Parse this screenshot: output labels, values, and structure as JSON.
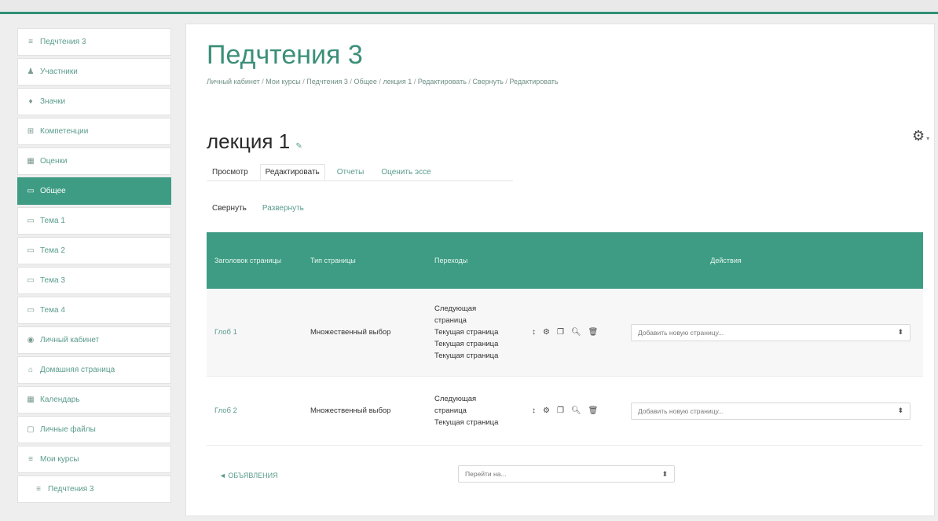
{
  "topbar": {
    "breadcrumb_faint": ""
  },
  "sidebar": {
    "items": [
      {
        "icon": "graduation-cap-icon",
        "glyph": "≡",
        "label": "Педчтения 3"
      },
      {
        "icon": "users-icon",
        "glyph": "♟",
        "label": "Участники"
      },
      {
        "icon": "badge-icon",
        "glyph": "♦",
        "label": "Значки"
      },
      {
        "icon": "competencies-icon",
        "glyph": "⊞",
        "label": "Компетенции"
      },
      {
        "icon": "grades-icon",
        "glyph": "▦",
        "label": "Оценки"
      },
      {
        "icon": "folder-icon",
        "glyph": "▭",
        "label": "Общее",
        "active": true
      },
      {
        "icon": "folder-icon",
        "glyph": "▭",
        "label": "Тема 1"
      },
      {
        "icon": "folder-icon",
        "glyph": "▭",
        "label": "Тема 2"
      },
      {
        "icon": "folder-icon",
        "glyph": "▭",
        "label": "Тема 3"
      },
      {
        "icon": "folder-icon",
        "glyph": "▭",
        "label": "Тема 4"
      },
      {
        "icon": "dashboard-icon",
        "glyph": "◉",
        "label": "Личный кабинет"
      },
      {
        "icon": "home-icon",
        "glyph": "⌂",
        "label": "Домашняя страница"
      },
      {
        "icon": "calendar-icon",
        "glyph": "▦",
        "label": "Календарь"
      },
      {
        "icon": "file-icon",
        "glyph": "▢",
        "label": "Личные файлы"
      },
      {
        "icon": "graduation-cap-icon",
        "glyph": "≡",
        "label": "Мои курсы"
      },
      {
        "icon": "graduation-cap-icon",
        "glyph": "≡",
        "label": "Педчтения 3",
        "indent": true
      }
    ]
  },
  "header": {
    "title": "Педчтения 3",
    "breadcrumb": [
      "Личный кабинет",
      "Мои курсы",
      "Педчтения 3",
      "Общее",
      "лекция 1",
      "Редактировать",
      "Свернуть",
      "Редактировать"
    ]
  },
  "lesson": {
    "title": "лекция 1",
    "tabs": [
      "Просмотр",
      "Редактировать",
      "Отчеты",
      "Оценить эссе"
    ],
    "subtabs": [
      "Свернуть",
      "Развернуть"
    ]
  },
  "table": {
    "headers": [
      "Заголовок страницы",
      "Тип страницы",
      "Переходы",
      "Действия"
    ],
    "rows": [
      {
        "title": "Глоб 1",
        "type": "Множественный выбор",
        "jumps": [
          "Следующая",
          "страница",
          "Текущая страница",
          "Текущая страница",
          "Текущая страница"
        ],
        "add_page": "Добавить новую страницу..."
      },
      {
        "title": "Глоб 2",
        "type": "Множественный выбор",
        "jumps": [
          "Следующая",
          "страница",
          "Текущая страница"
        ],
        "add_page": "Добавить новую страницу..."
      }
    ],
    "action_icons": [
      "move-icon",
      "settings-icon",
      "copy-icon",
      "preview-icon",
      "delete-icon"
    ]
  },
  "footer": {
    "prev_link": "◄ ОБЪЯВЛЕНИЯ",
    "jump_label": "Перейти на..."
  }
}
